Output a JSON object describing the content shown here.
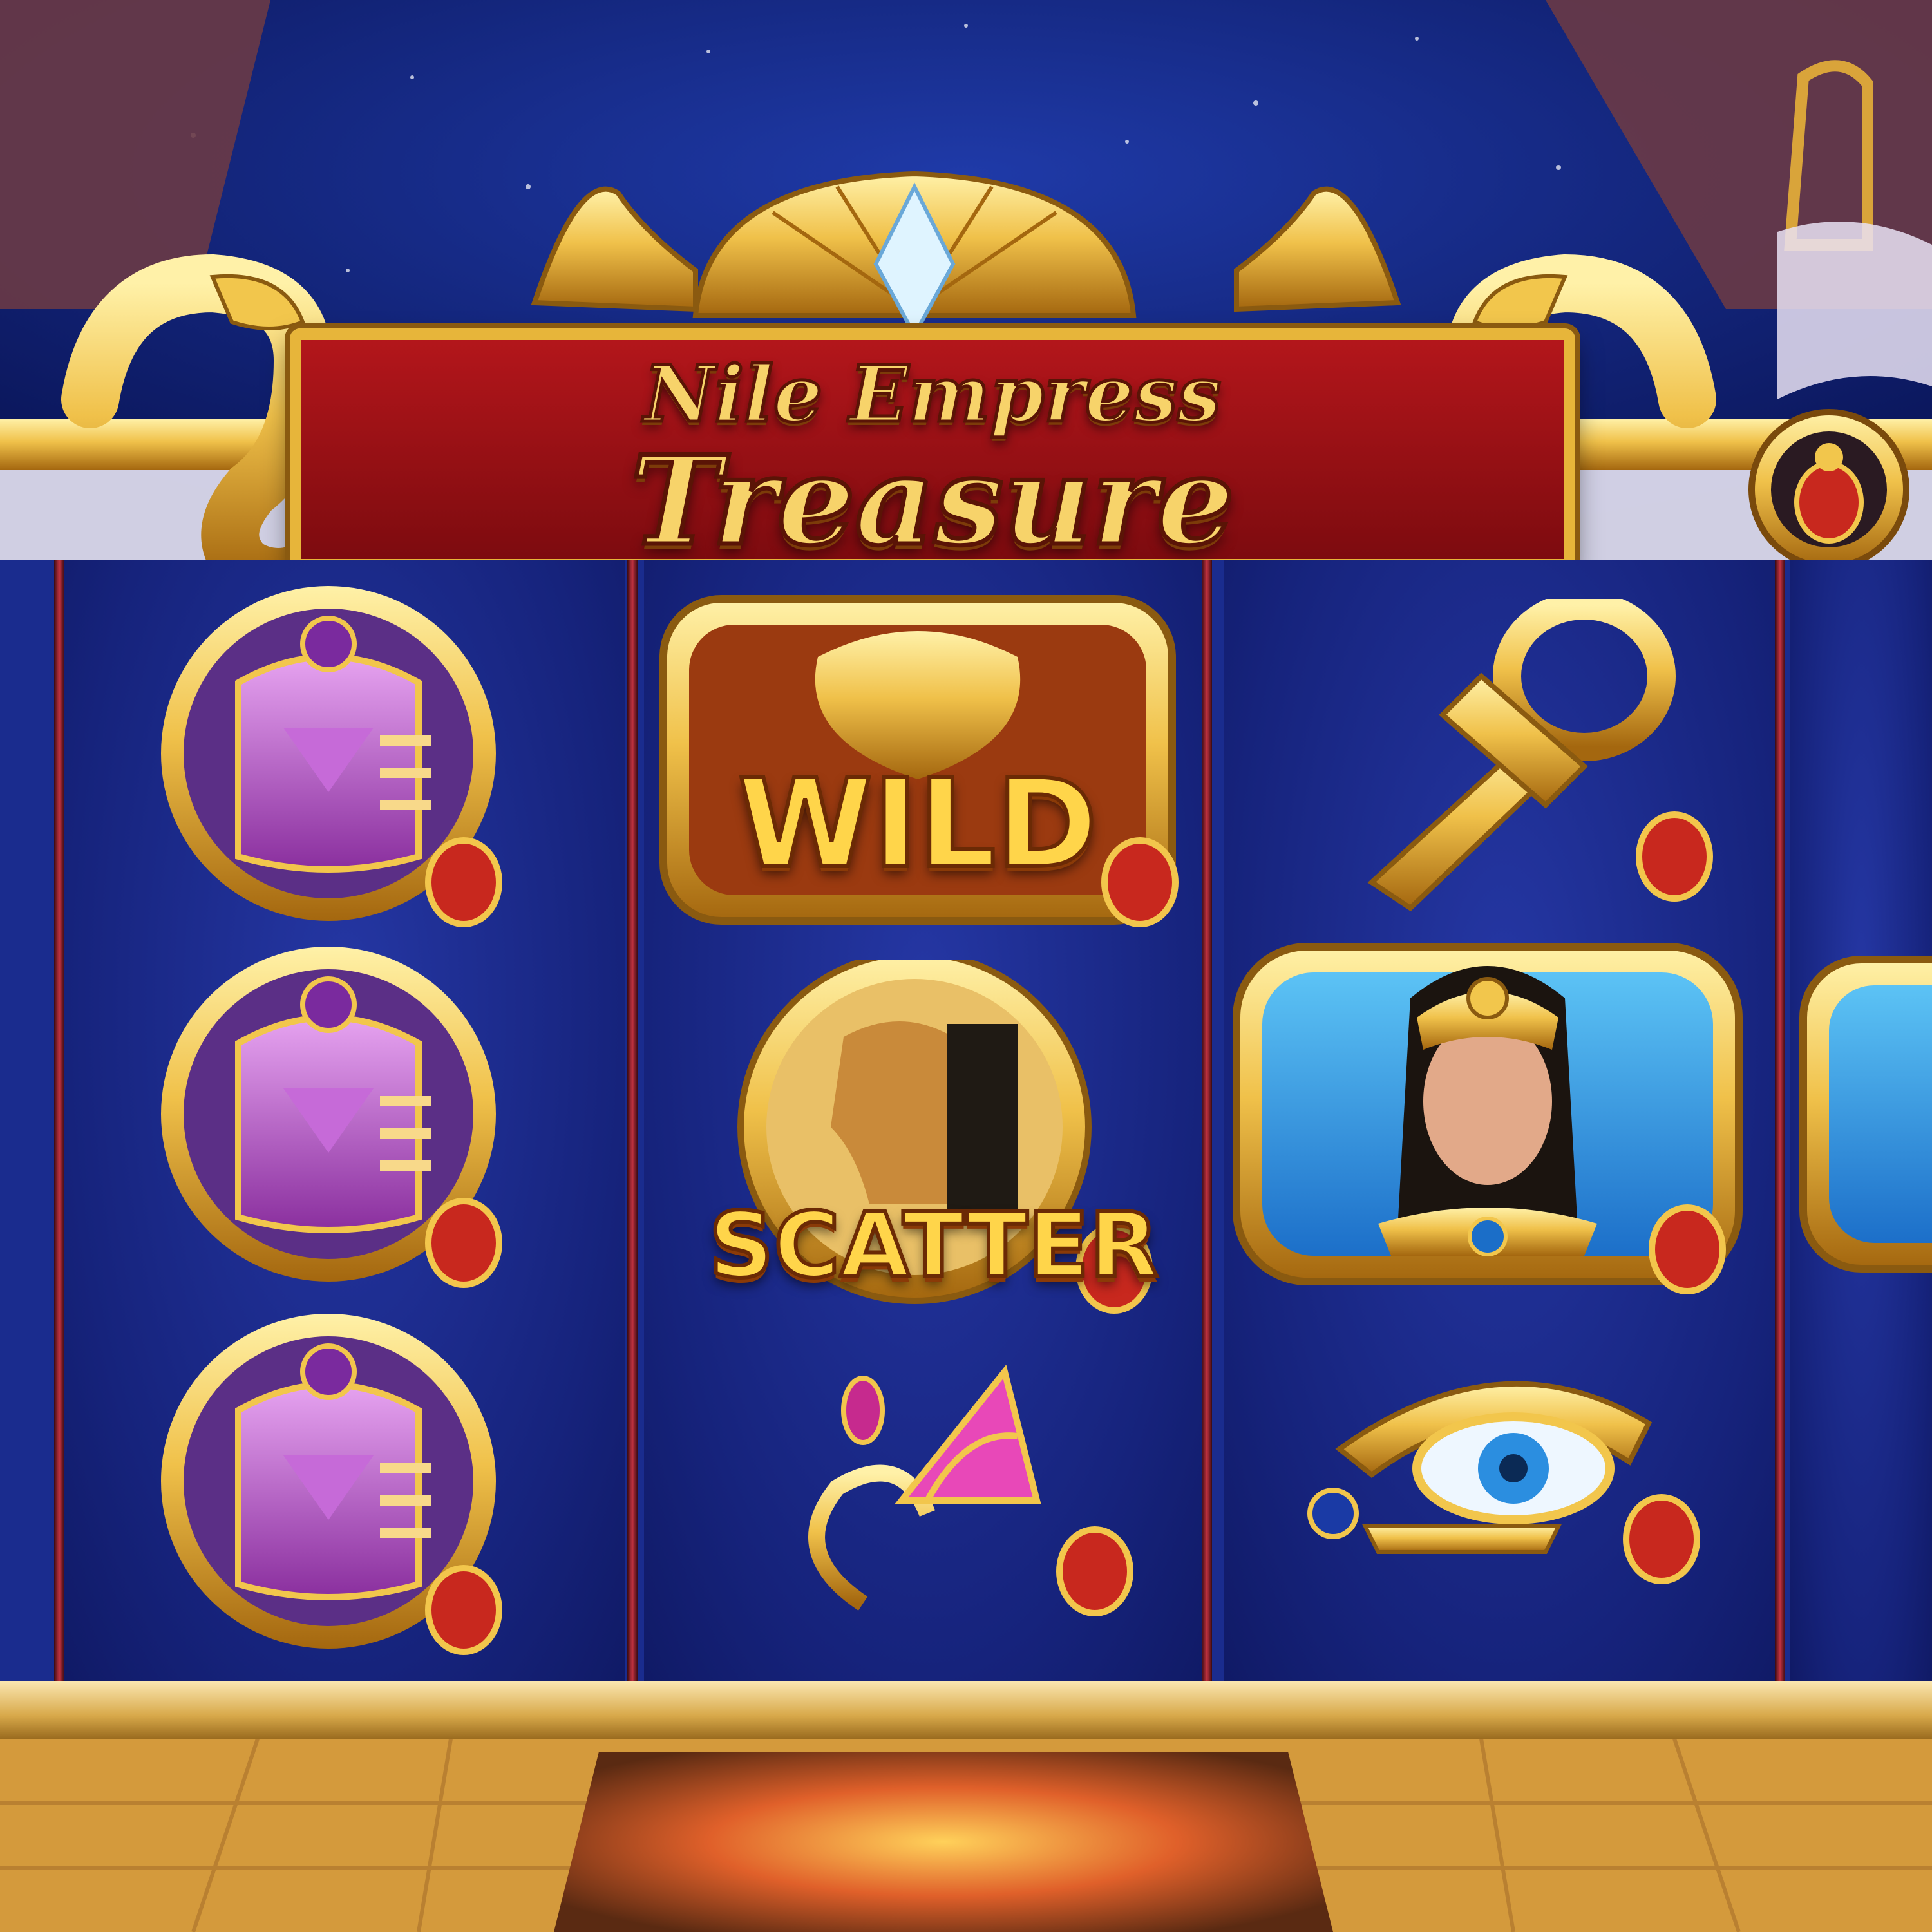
{
  "game": {
    "title_line1": "Nile Empress",
    "title_line2": "Treasure"
  },
  "reels": [
    {
      "symbols": [
        {
          "name": "falcon-sphinx",
          "label": ""
        },
        {
          "name": "falcon-sphinx",
          "label": ""
        },
        {
          "name": "falcon-sphinx",
          "label": ""
        }
      ]
    },
    {
      "symbols": [
        {
          "name": "lion-wild",
          "label": "WILD"
        },
        {
          "name": "queen-profile-scatter",
          "label": "SCATTER"
        },
        {
          "name": "lotus-flower",
          "label": ""
        }
      ]
    },
    {
      "symbols": [
        {
          "name": "ankh",
          "label": ""
        },
        {
          "name": "empress-portrait",
          "label": ""
        },
        {
          "name": "eye-of-horus",
          "label": ""
        }
      ]
    }
  ],
  "colors": {
    "sky": "#0d1e6e",
    "reel_background": "#16237c",
    "gold": "#e7b53a",
    "banner_red": "#b3161b",
    "scarab_red": "#c8281e"
  }
}
